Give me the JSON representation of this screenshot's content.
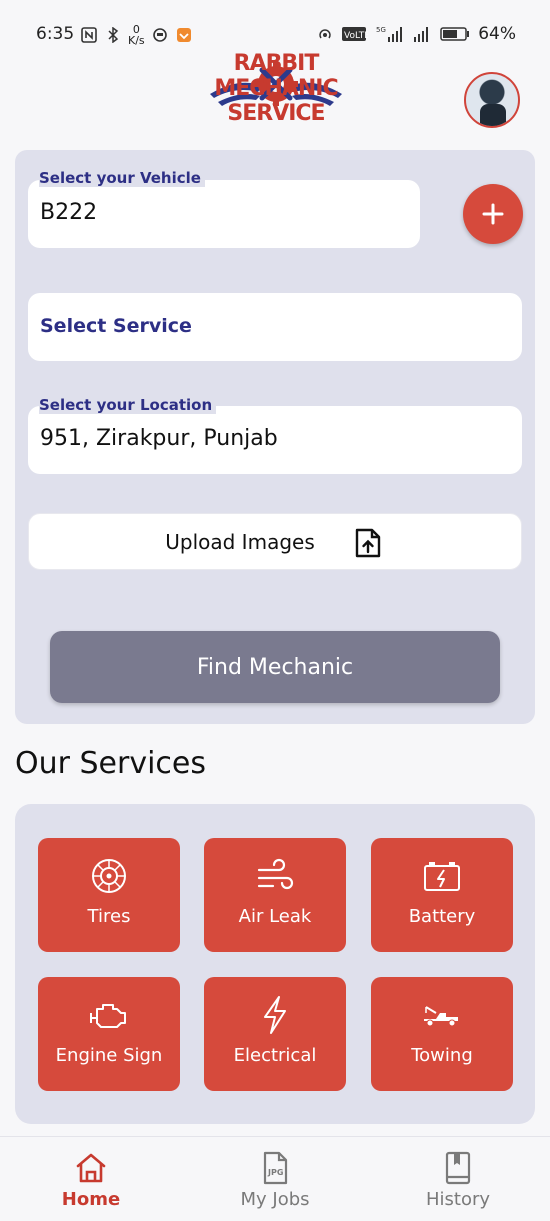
{
  "status_bar": {
    "time": "6:35",
    "net_speed_top": "0",
    "net_speed_bottom": "K/s",
    "battery": "64%"
  },
  "header": {
    "logo_text": "RABBIT MECHANIC SERVICE"
  },
  "form": {
    "vehicle": {
      "label": "Select your Vehicle",
      "value": "B222"
    },
    "add_button": "+",
    "service": {
      "label": "Select Service"
    },
    "location": {
      "label": "Select your Location",
      "value": "951, Zirakpur, Punjab"
    },
    "upload": {
      "label": "Upload Images"
    },
    "find_button": "Find Mechanic"
  },
  "services": {
    "title": "Our Services",
    "items": [
      {
        "label": "Tires",
        "icon": "tire-icon"
      },
      {
        "label": "Air Leak",
        "icon": "wind-icon"
      },
      {
        "label": "Battery",
        "icon": "battery-icon"
      },
      {
        "label": "Engine Sign",
        "icon": "engine-icon"
      },
      {
        "label": "Electrical",
        "icon": "lightning-icon"
      },
      {
        "label": "Towing",
        "icon": "tow-truck-icon"
      }
    ]
  },
  "nav": {
    "items": [
      {
        "label": "Home",
        "icon": "home-icon",
        "active": true
      },
      {
        "label": "My Jobs",
        "icon": "jpg-file-icon",
        "active": false
      },
      {
        "label": "History",
        "icon": "book-icon",
        "active": false
      }
    ]
  },
  "colors": {
    "accent": "#d64a3c",
    "label_blue": "#2d2f85",
    "card_bg": "#dfe0ec",
    "button_gray": "#7a7a8f"
  }
}
